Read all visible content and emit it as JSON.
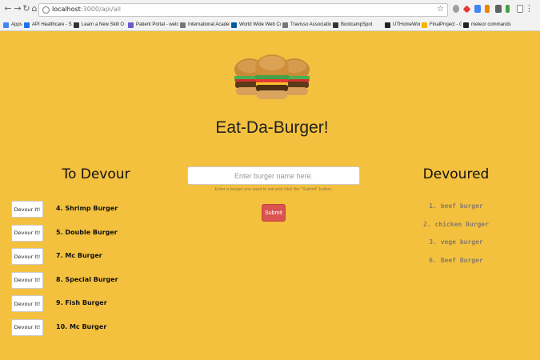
{
  "browser": {
    "url_host": "localhost",
    "url_path": ":3000/api/all",
    "bookmarks": [
      {
        "label": "Apps",
        "color": "#4285f4"
      },
      {
        "label": "API Healthcare - Sh",
        "color": "#1a73e8"
      },
      {
        "label": "Learn a New Skill O",
        "color": "#333333"
      },
      {
        "label": "Patient Portal - welc",
        "color": "#6a5acd"
      },
      {
        "label": "International Academ",
        "color": "#777777"
      },
      {
        "label": "World Wide Web Co",
        "color": "#005a9c"
      },
      {
        "label": "Travisso Association",
        "color": "#777777"
      },
      {
        "label": "BootcampSpot",
        "color": "#333333"
      },
      {
        "label": "UTHomeWork",
        "color": "#222222"
      },
      {
        "label": "FinalProject - Googl",
        "color": "#f4b400"
      },
      {
        "label": "meteor commands",
        "color": "#222222"
      }
    ]
  },
  "page": {
    "title": "Eat-Da-Burger!",
    "to_devour_heading": "To Devour",
    "devoured_heading": "Devoured",
    "input_placeholder": "Enter burger name here.",
    "help_text": "Enter a burger you want to eat and click the \"Submit\" button.",
    "submit_label": "Submit",
    "devour_button_label": "Devour It!",
    "to_devour": [
      "4. Shrimp Burger",
      "5. Double Burger",
      "7. Mc Burger",
      "8. Special Burger",
      "9. Fish Burger",
      "10. Mc Burger"
    ],
    "devoured": [
      "1. beef burger",
      "2. chicken Burger",
      "3. vege burger",
      "6. Beef Burger"
    ]
  },
  "colors": {
    "background": "#f4c13e",
    "submit": "#d9534f",
    "devoured_text": "#8a7a66"
  }
}
